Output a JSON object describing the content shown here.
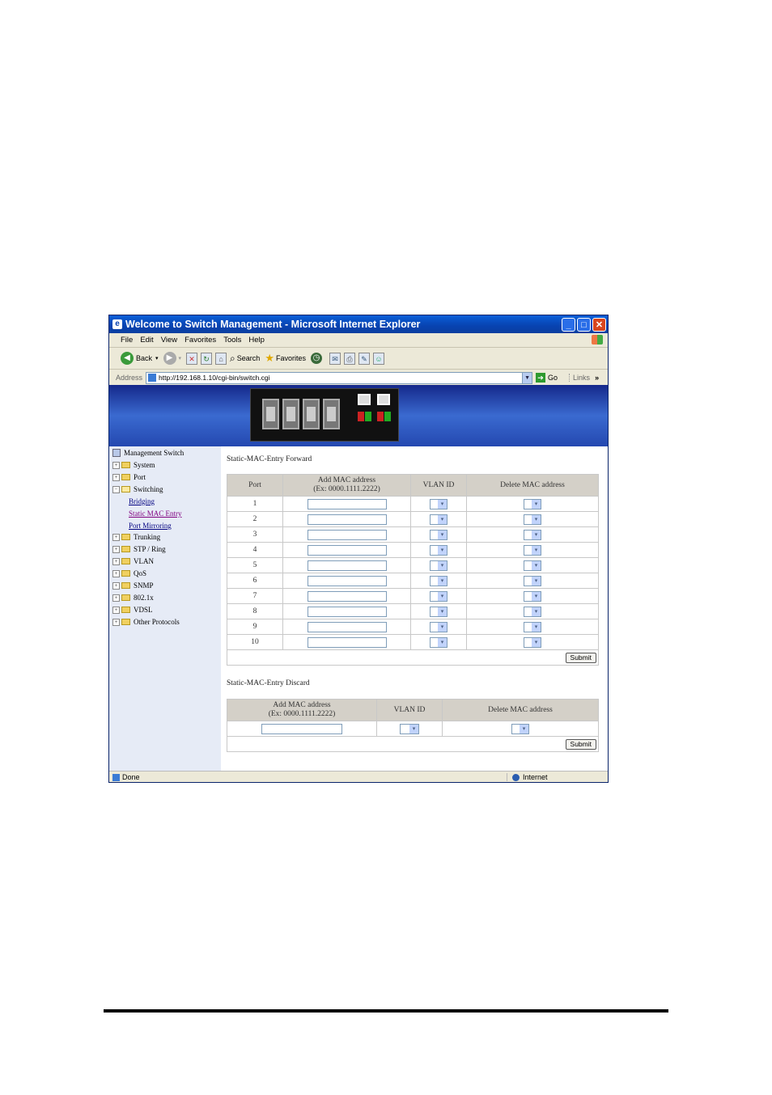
{
  "window": {
    "title": "Welcome to Switch Management - Microsoft Internet Explorer",
    "minimize": "_",
    "maximize": "□",
    "close": "✕"
  },
  "menu": [
    "File",
    "Edit",
    "View",
    "Favorites",
    "Tools",
    "Help"
  ],
  "toolbar": {
    "back": "Back",
    "search": "Search",
    "favorites": "Favorites"
  },
  "address": {
    "label": "Address",
    "url": "http://192.168.1.10/cgi-bin/switch.cgi",
    "go": "Go",
    "links": "Links"
  },
  "sidebar": {
    "root": "Management Switch",
    "items": [
      {
        "label": "System",
        "pm": "+"
      },
      {
        "label": "Port",
        "pm": "+"
      },
      {
        "label": "Switching",
        "pm": "−"
      },
      {
        "label": "Trunking",
        "pm": "+"
      },
      {
        "label": "STP / Ring",
        "pm": "+"
      },
      {
        "label": "VLAN",
        "pm": "+"
      },
      {
        "label": "QoS",
        "pm": "+"
      },
      {
        "label": "SNMP",
        "pm": "+"
      },
      {
        "label": "802.1x",
        "pm": "+"
      },
      {
        "label": "VDSL",
        "pm": "+"
      },
      {
        "label": "Other Protocols",
        "pm": "+"
      }
    ],
    "sublinks": [
      "Bridging",
      "Static MAC Entry",
      "Port Mirroring"
    ]
  },
  "forward": {
    "title": "Static-MAC-Entry Forward",
    "headers": {
      "port": "Port",
      "mac_line1": "Add MAC address",
      "mac_line2": "(Ex: 0000.1111.2222)",
      "vlan": "VLAN ID",
      "delete": "Delete MAC address"
    },
    "ports": [
      "1",
      "2",
      "3",
      "4",
      "5",
      "6",
      "7",
      "8",
      "9",
      "10"
    ],
    "submit": "Submit"
  },
  "discard": {
    "title": "Static-MAC-Entry Discard",
    "headers": {
      "mac_line1": "Add MAC address",
      "mac_line2": "(Ex: 0000.1111.2222)",
      "vlan": "VLAN ID",
      "delete": "Delete MAC address"
    },
    "submit": "Submit"
  },
  "status": {
    "left": "Done",
    "zone": "Internet"
  }
}
